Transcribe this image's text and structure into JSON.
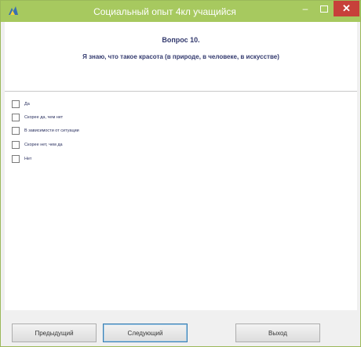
{
  "window": {
    "title": "Социальный опыт 4кл учащийся",
    "accent": "#a7c95f",
    "close_color": "#c7403a",
    "minimize_glyph": "–",
    "close_glyph": "✕"
  },
  "question": {
    "number": "Вопрос 10.",
    "text": "Я знаю, что такое красота (в природе, в человеке, в искусстве)"
  },
  "answers": [
    {
      "label": "Да",
      "checked": false
    },
    {
      "label": "Скорее да, чем нет",
      "checked": false
    },
    {
      "label": "В зависимости от ситуации",
      "checked": false
    },
    {
      "label": "Скорее нет, чем да",
      "checked": false
    },
    {
      "label": "Нет",
      "checked": false
    }
  ],
  "buttons": {
    "prev": "Предыдущий",
    "next": "Следующий",
    "exit": "Выход"
  }
}
